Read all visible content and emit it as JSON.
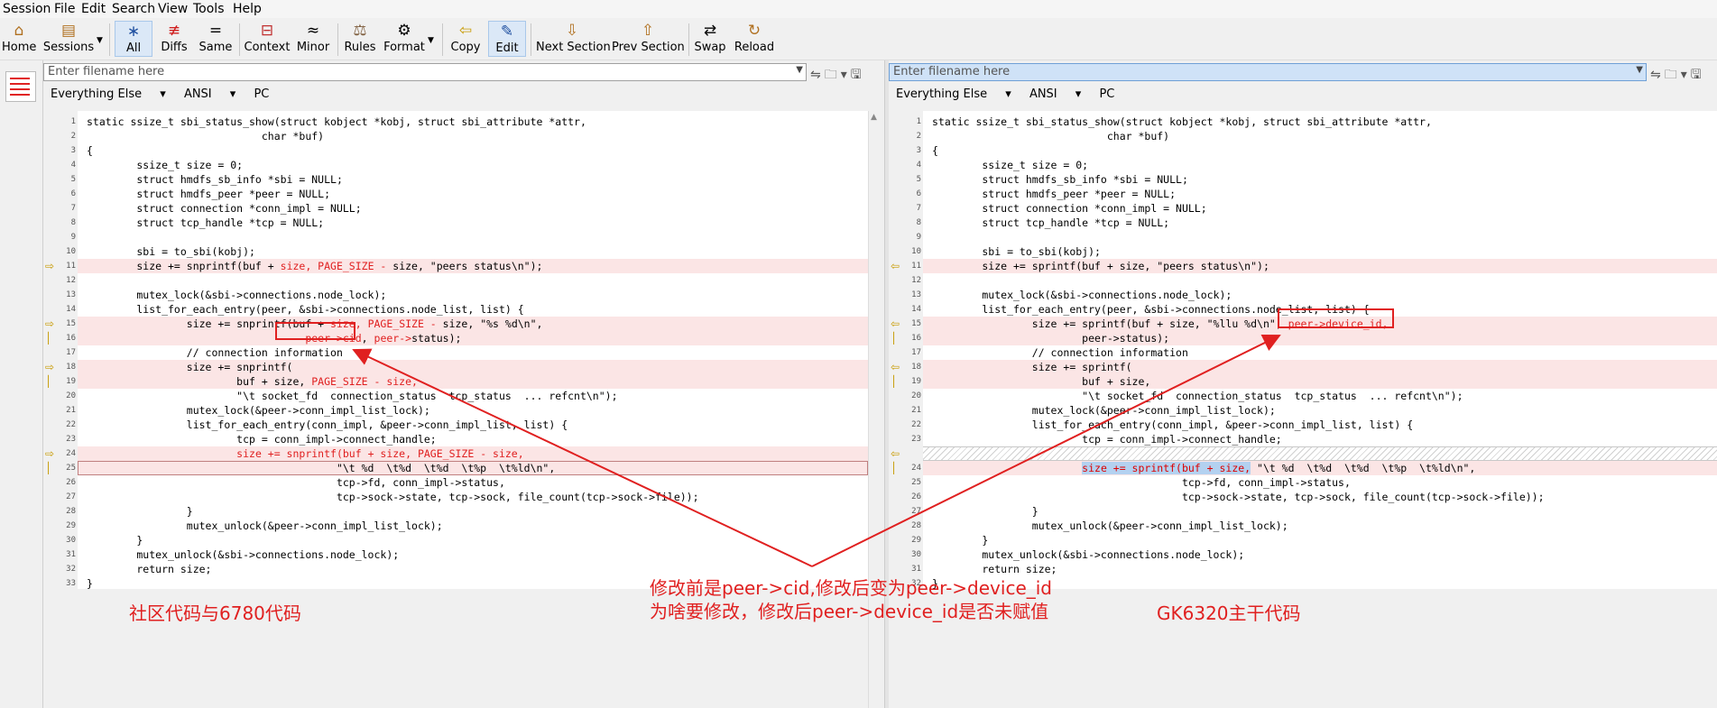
{
  "menubar": {
    "items": [
      "Session",
      "File",
      "Edit",
      "Search",
      "View",
      "Tools",
      "Help"
    ]
  },
  "toolbar": {
    "buttons": [
      {
        "label": "Home",
        "icon": "home-icon",
        "glyph": "⌂"
      },
      {
        "label": "Sessions",
        "icon": "sessions-icon",
        "glyph": "▤"
      },
      {
        "label": "All",
        "icon": "all-icon",
        "glyph": "∗"
      },
      {
        "label": "Diffs",
        "icon": "diffs-icon",
        "glyph": "≢"
      },
      {
        "label": "Same",
        "icon": "same-icon",
        "glyph": "="
      },
      {
        "label": "Context",
        "icon": "context-icon",
        "glyph": "⊟"
      },
      {
        "label": "Minor",
        "icon": "minor-icon",
        "glyph": "≈"
      },
      {
        "label": "Rules",
        "icon": "rules-icon",
        "glyph": "⚖"
      },
      {
        "label": "Format",
        "icon": "format-icon",
        "glyph": "⚙"
      },
      {
        "label": "Copy",
        "icon": "copy-icon",
        "glyph": "⇦"
      },
      {
        "label": "Edit",
        "icon": "edit-icon",
        "glyph": "✎"
      },
      {
        "label": "Next Section",
        "icon": "next-section-icon",
        "glyph": "⇩"
      },
      {
        "label": "Prev Section",
        "icon": "prev-section-icon",
        "glyph": "⇧"
      },
      {
        "label": "Swap",
        "icon": "swap-icon",
        "glyph": "⇄"
      },
      {
        "label": "Reload",
        "icon": "reload-icon",
        "glyph": "↻"
      }
    ]
  },
  "left_pane": {
    "filename_placeholder": "Enter filename here",
    "format": [
      "Everything Else",
      "ANSI",
      "PC"
    ],
    "lines": [
      {
        "n": "1",
        "t": "static ssize_t sbi_status_show(struct kobject *kobj, struct sbi_attribute *attr,"
      },
      {
        "n": "2",
        "t": "                            char *buf)"
      },
      {
        "n": "3",
        "t": "{"
      },
      {
        "n": "4",
        "t": "        ssize_t size = 0;"
      },
      {
        "n": "5",
        "t": "        struct hmdfs_sb_info *sbi = NULL;"
      },
      {
        "n": "6",
        "t": "        struct hmdfs_peer *peer = NULL;"
      },
      {
        "n": "7",
        "t": "        struct connection *conn_impl = NULL;"
      },
      {
        "n": "8",
        "t": "        struct tcp_handle *tcp = NULL;"
      },
      {
        "n": "9",
        "t": ""
      },
      {
        "n": "10",
        "t": "        sbi = to_sbi(kobj);"
      },
      {
        "n": "11",
        "t": "        size += snprintf(buf + size, PAGE_SIZE - size, \"peers status\\n\");"
      },
      {
        "n": "12",
        "t": ""
      },
      {
        "n": "13",
        "t": "        mutex_lock(&sbi->connections.node_lock);"
      },
      {
        "n": "14",
        "t": "        list_for_each_entry(peer, &sbi->connections.node_list, list) {"
      },
      {
        "n": "15",
        "t": "                size += snprintf(buf + size, PAGE_SIZE - size, \"%s %d\\n\","
      },
      {
        "n": "16",
        "t": "                                   peer->cid, peer->status);"
      },
      {
        "n": "17",
        "t": "                // connection information"
      },
      {
        "n": "18",
        "t": "                size += snprintf("
      },
      {
        "n": "19",
        "t": "                        buf + size, PAGE_SIZE - size,"
      },
      {
        "n": "20",
        "t": "                        \"\\t socket_fd  connection_status  tcp_status  ... refcnt\\n\");"
      },
      {
        "n": "21",
        "t": "                mutex_lock(&peer->conn_impl_list_lock);"
      },
      {
        "n": "22",
        "t": "                list_for_each_entry(conn_impl, &peer->conn_impl_list, list) {"
      },
      {
        "n": "23",
        "t": "                        tcp = conn_impl->connect_handle;"
      },
      {
        "n": "24",
        "t": "                        size += snprintf(buf + size, PAGE_SIZE - size,"
      },
      {
        "n": "25",
        "t": "                                        \"\\t %d  \\t%d  \\t%d  \\t%p  \\t%ld\\n\","
      },
      {
        "n": "26",
        "t": "                                        tcp->fd, conn_impl->status,"
      },
      {
        "n": "27",
        "t": "                                        tcp->sock->state, tcp->sock, file_count(tcp->sock->file));"
      },
      {
        "n": "28",
        "t": "                }"
      },
      {
        "n": "29",
        "t": "                mutex_unlock(&peer->conn_impl_list_lock);"
      },
      {
        "n": "30",
        "t": "        }"
      },
      {
        "n": "31",
        "t": "        mutex_unlock(&sbi->connections.node_lock);"
      },
      {
        "n": "32",
        "t": "        return size;"
      },
      {
        "n": "33",
        "t": "}"
      }
    ]
  },
  "right_pane": {
    "filename_placeholder": "Enter filename here",
    "format": [
      "Everything Else",
      "ANSI",
      "PC"
    ],
    "lines": [
      {
        "n": "1",
        "t": "static ssize_t sbi_status_show(struct kobject *kobj, struct sbi_attribute *attr,"
      },
      {
        "n": "2",
        "t": "                            char *buf)"
      },
      {
        "n": "3",
        "t": "{"
      },
      {
        "n": "4",
        "t": "        ssize_t size = 0;"
      },
      {
        "n": "5",
        "t": "        struct hmdfs_sb_info *sbi = NULL;"
      },
      {
        "n": "6",
        "t": "        struct hmdfs_peer *peer = NULL;"
      },
      {
        "n": "7",
        "t": "        struct connection *conn_impl = NULL;"
      },
      {
        "n": "8",
        "t": "        struct tcp_handle *tcp = NULL;"
      },
      {
        "n": "9",
        "t": ""
      },
      {
        "n": "10",
        "t": "        sbi = to_sbi(kobj);"
      },
      {
        "n": "11",
        "t": "        size += sprintf(buf + size, \"peers status\\n\");"
      },
      {
        "n": "12",
        "t": ""
      },
      {
        "n": "13",
        "t": "        mutex_lock(&sbi->connections.node_lock);"
      },
      {
        "n": "14",
        "t": "        list_for_each_entry(peer, &sbi->connections.node_list, list) {"
      },
      {
        "n": "15",
        "t": "                size += sprintf(buf + size, \"%llu %d\\n\", peer->device_id,"
      },
      {
        "n": "16",
        "t": "                        peer->status);"
      },
      {
        "n": "17",
        "t": "                // connection information"
      },
      {
        "n": "18",
        "t": "                size += sprintf("
      },
      {
        "n": "19",
        "t": "                        buf + size,"
      },
      {
        "n": "20",
        "t": "                        \"\\t socket_fd  connection_status  tcp_status  ... refcnt\\n\");"
      },
      {
        "n": "21",
        "t": "                mutex_lock(&peer->conn_impl_list_lock);"
      },
      {
        "n": "22",
        "t": "                list_for_each_entry(conn_impl, &peer->conn_impl_list, list) {"
      },
      {
        "n": "23",
        "t": "                        tcp = conn_impl->connect_handle;"
      },
      {
        "n": "",
        "t": ""
      },
      {
        "n": "24",
        "t": "                        size += sprintf(buf + size, \"\\t %d  \\t%d  \\t%d  \\t%p  \\t%ld\\n\","
      },
      {
        "n": "25",
        "t": "                                        tcp->fd, conn_impl->status,"
      },
      {
        "n": "26",
        "t": "                                        tcp->sock->state, tcp->sock, file_count(tcp->sock->file));"
      },
      {
        "n": "27",
        "t": "                }"
      },
      {
        "n": "28",
        "t": "                mutex_unlock(&peer->conn_impl_list_lock);"
      },
      {
        "n": "29",
        "t": "        }"
      },
      {
        "n": "30",
        "t": "        mutex_unlock(&sbi->connections.node_lock);"
      },
      {
        "n": "31",
        "t": "        return size;"
      },
      {
        "n": "32",
        "t": "}"
      }
    ]
  },
  "annotations": {
    "left_label": "社区代码与6780代码",
    "center_line1": "修改前是peer->cid,修改后变为peer->device_id",
    "center_line2": "为啥要修改，修改后peer->device_id是否未赋值",
    "right_label": "GK6320主干代码"
  },
  "colors": {
    "diff_bg": "#fbe5e5",
    "annotation": "#e02020",
    "marker": "#c79a00",
    "selection": "#b3d1f0"
  }
}
